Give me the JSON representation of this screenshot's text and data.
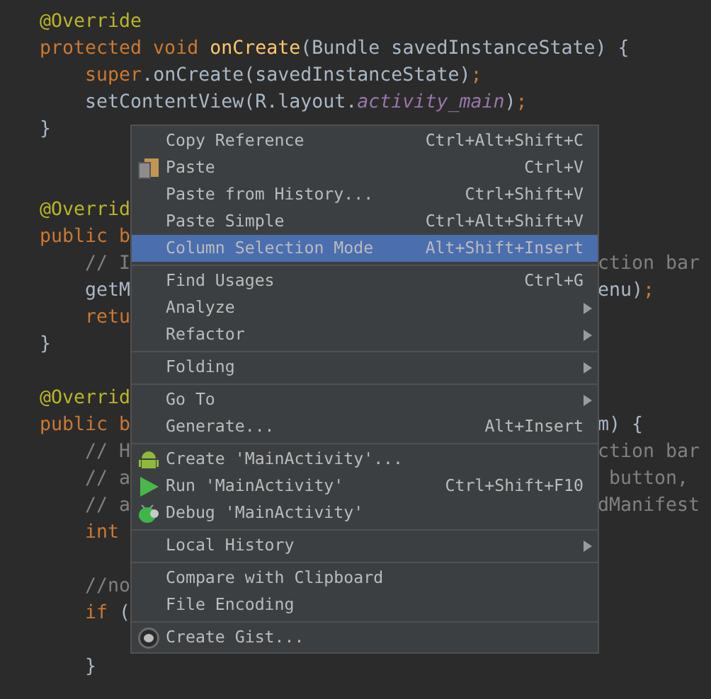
{
  "editor": {
    "lines": [
      {
        "kind": "code",
        "tokens": [
          {
            "kind": "annotation",
            "text": "@Override"
          }
        ]
      },
      {
        "kind": "code",
        "tokens": [
          {
            "kind": "keyword",
            "text": "protected void "
          },
          {
            "kind": "method",
            "text": "onCreate"
          },
          {
            "kind": "plain",
            "text": "(Bundle savedInstanceState) {"
          }
        ]
      },
      {
        "kind": "code",
        "tokens": [
          {
            "kind": "keyword",
            "text": "    super"
          },
          {
            "kind": "plain",
            "text": ".onCreate(savedInstanceState)"
          },
          {
            "kind": "keyword",
            "text": ";"
          }
        ]
      },
      {
        "kind": "code",
        "tokens": [
          {
            "kind": "plain",
            "text": "    setContentView(R.layout."
          },
          {
            "kind": "field",
            "text": "activity_main"
          },
          {
            "kind": "plain",
            "text": ")"
          },
          {
            "kind": "keyword",
            "text": ";"
          }
        ]
      },
      {
        "kind": "code",
        "tokens": [
          {
            "kind": "plain",
            "text": "}"
          }
        ]
      },
      {
        "kind": "blank"
      },
      {
        "kind": "blank"
      },
      {
        "kind": "code",
        "tokens": [
          {
            "kind": "annotation",
            "text": "@Overrid"
          }
        ]
      },
      {
        "kind": "code",
        "tokens": [
          {
            "kind": "keyword",
            "text": "public b"
          }
        ]
      },
      {
        "kind": "code",
        "tokens": [
          {
            "kind": "comment",
            "text": "    // I"
          }
        ],
        "right": [
          {
            "kind": "comment",
            "text": "ction bar"
          }
        ]
      },
      {
        "kind": "code",
        "tokens": [
          {
            "kind": "plain",
            "text": "    getM"
          }
        ],
        "right": [
          {
            "kind": "plain",
            "text": "enu)"
          },
          {
            "kind": "keyword",
            "text": ";"
          }
        ]
      },
      {
        "kind": "code",
        "tokens": [
          {
            "kind": "keyword",
            "text": "    retu"
          }
        ]
      },
      {
        "kind": "code",
        "tokens": [
          {
            "kind": "plain",
            "text": "}"
          }
        ]
      },
      {
        "kind": "blank"
      },
      {
        "kind": "code",
        "tokens": [
          {
            "kind": "annotation",
            "text": "@Overrid"
          }
        ]
      },
      {
        "kind": "code",
        "tokens": [
          {
            "kind": "keyword",
            "text": "public b"
          }
        ],
        "right": [
          {
            "kind": "plain",
            "text": "m) {"
          }
        ]
      },
      {
        "kind": "code",
        "tokens": [
          {
            "kind": "comment",
            "text": "    // H"
          }
        ],
        "right": [
          {
            "kind": "comment",
            "text": "ction bar"
          }
        ]
      },
      {
        "kind": "code",
        "tokens": [
          {
            "kind": "comment",
            "text": "    // a"
          }
        ],
        "right": [
          {
            "kind": "comment",
            "text": " button,"
          }
        ]
      },
      {
        "kind": "code",
        "tokens": [
          {
            "kind": "comment",
            "text": "    // a"
          }
        ],
        "right": [
          {
            "kind": "comment",
            "text": "dManifest"
          }
        ]
      },
      {
        "kind": "code",
        "tokens": [
          {
            "kind": "keyword",
            "text": "    int"
          }
        ]
      },
      {
        "kind": "blank"
      },
      {
        "kind": "code",
        "tokens": [
          {
            "kind": "comment",
            "text": "    //no"
          }
        ]
      },
      {
        "kind": "code",
        "tokens": [
          {
            "kind": "keyword",
            "text": "    if"
          },
          {
            "kind": "plain",
            "text": " ("
          }
        ]
      },
      {
        "kind": "blank"
      },
      {
        "kind": "code",
        "tokens": [
          {
            "kind": "plain",
            "text": "    }"
          }
        ]
      }
    ]
  },
  "context_menu": {
    "sections": [
      {
        "items": [
          {
            "kind": "plain",
            "label": "Copy Reference",
            "shortcut": "Ctrl+Alt+Shift+C",
            "selected": false,
            "submenu": false
          },
          {
            "kind": "paste",
            "label": "Paste",
            "shortcut": "Ctrl+V",
            "selected": false,
            "submenu": false
          },
          {
            "kind": "plain",
            "label": "Paste from History...",
            "shortcut": "Ctrl+Shift+V",
            "selected": false,
            "submenu": false
          },
          {
            "kind": "plain",
            "label": "Paste Simple",
            "shortcut": "Ctrl+Alt+Shift+V",
            "selected": false,
            "submenu": false
          },
          {
            "kind": "plain",
            "label": "Column Selection Mode",
            "shortcut": "Alt+Shift+Insert",
            "selected": true,
            "submenu": false
          }
        ]
      },
      {
        "items": [
          {
            "kind": "plain",
            "label": "Find Usages",
            "shortcut": "Ctrl+G",
            "selected": false,
            "submenu": false
          },
          {
            "kind": "plain",
            "label": "Analyze",
            "selected": false,
            "submenu": true
          },
          {
            "kind": "plain",
            "label": "Refactor",
            "selected": false,
            "submenu": true
          }
        ]
      },
      {
        "items": [
          {
            "kind": "plain",
            "label": "Folding",
            "selected": false,
            "submenu": true
          }
        ]
      },
      {
        "items": [
          {
            "kind": "plain",
            "label": "Go To",
            "selected": false,
            "submenu": true
          },
          {
            "kind": "plain",
            "label": "Generate...",
            "shortcut": "Alt+Insert",
            "selected": false,
            "submenu": false
          }
        ]
      },
      {
        "items": [
          {
            "kind": "android",
            "label": "Create 'MainActivity'...",
            "selected": false,
            "submenu": false
          },
          {
            "kind": "run",
            "label": "Run 'MainActivity'",
            "shortcut": "Ctrl+Shift+F10",
            "selected": false,
            "submenu": false
          },
          {
            "kind": "debug",
            "label": "Debug 'MainActivity'",
            "selected": false,
            "submenu": false
          }
        ]
      },
      {
        "items": [
          {
            "kind": "plain",
            "label": "Local History",
            "selected": false,
            "submenu": true
          }
        ]
      },
      {
        "items": [
          {
            "kind": "plain",
            "label": "Compare with Clipboard",
            "selected": false,
            "submenu": false
          },
          {
            "kind": "plain",
            "label": "File Encoding",
            "selected": false,
            "submenu": false
          }
        ]
      },
      {
        "items": [
          {
            "kind": "github",
            "label": "Create Gist...",
            "selected": false,
            "submenu": false
          }
        ]
      }
    ]
  }
}
